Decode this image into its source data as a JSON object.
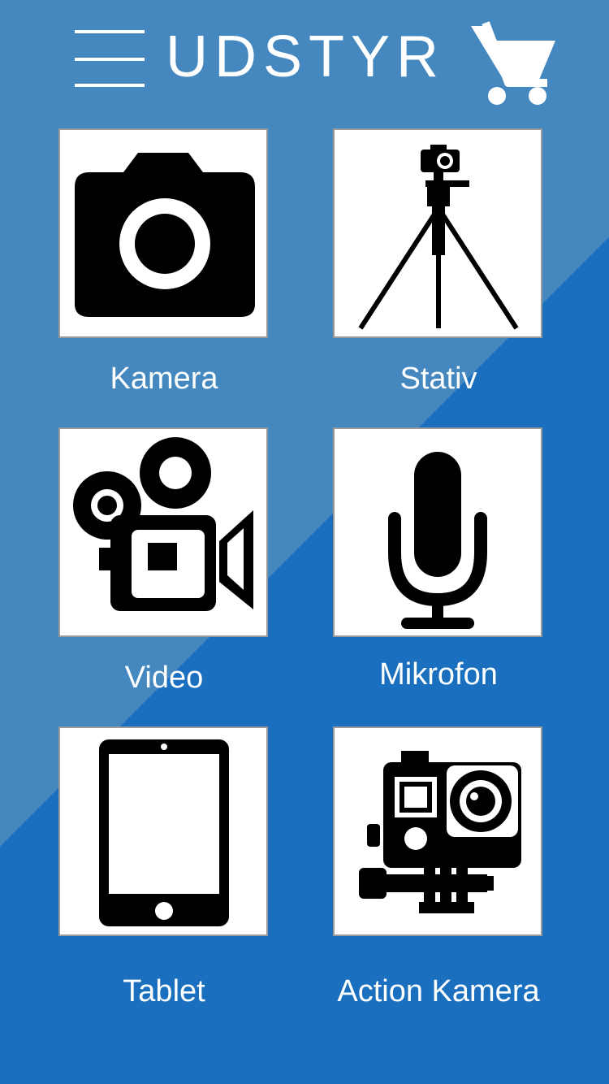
{
  "header": {
    "title": "UDSTYR",
    "menu_icon": "hamburger-menu-icon",
    "cart_icon": "shopping-cart-icon"
  },
  "colors": {
    "background_light": "#4488bf",
    "background_dark": "#1a6fbe",
    "tile_background": "#ffffff",
    "tile_border": "#9a9a9a",
    "icon": "#000000",
    "text": "#ffffff"
  },
  "categories": [
    {
      "label": "Kamera",
      "icon": "camera-icon"
    },
    {
      "label": "Stativ",
      "icon": "tripod-icon"
    },
    {
      "label": "Video",
      "icon": "video-camera-icon"
    },
    {
      "label": "Mikrofon",
      "icon": "microphone-icon"
    },
    {
      "label": "Tablet",
      "icon": "tablet-icon"
    },
    {
      "label": "Action Kamera",
      "icon": "action-camera-icon"
    }
  ]
}
